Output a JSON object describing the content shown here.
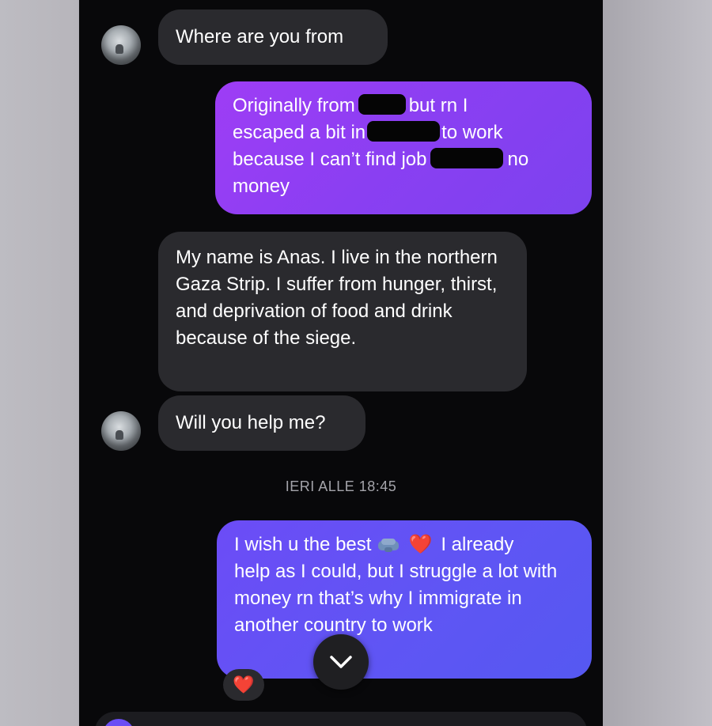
{
  "chat": {
    "messages": [
      {
        "side": "in",
        "text": "Where are you from"
      },
      {
        "side": "out",
        "parts": [
          "Originally from",
          "but rn I",
          "escaped a bit in",
          "to work",
          "because I can’t find job",
          "no",
          "money"
        ]
      },
      {
        "side": "in",
        "text": "My name is Anas. I live in the northern Gaza Strip. I suffer from hunger, thirst, and deprivation of food and drink because of the siege."
      },
      {
        "side": "in",
        "text": "Will you help me?"
      },
      {
        "side": "out",
        "line1_a": "I wish u the best",
        "line1_b": "I already",
        "rest": "help as I could, but I struggle a lot with money rn that’s why I immigrate in another country to work"
      }
    ],
    "timestamp": "IERI ALLE 18:45",
    "reaction": "❤️",
    "heart": "❤️"
  },
  "icons": {
    "avatar": "contact-avatar",
    "scroll": "chevron-down-icon",
    "emoji_handshake": "handshake-emoji",
    "emoji_heart": "red-heart-emoji"
  },
  "colors": {
    "background": "#08080a",
    "incoming_bubble": "#2a2a2e",
    "outgoing_bubble_1": "#8a3ff2",
    "outgoing_bubble_2": "#5f55f4",
    "timestamp": "#a4a4aa"
  }
}
